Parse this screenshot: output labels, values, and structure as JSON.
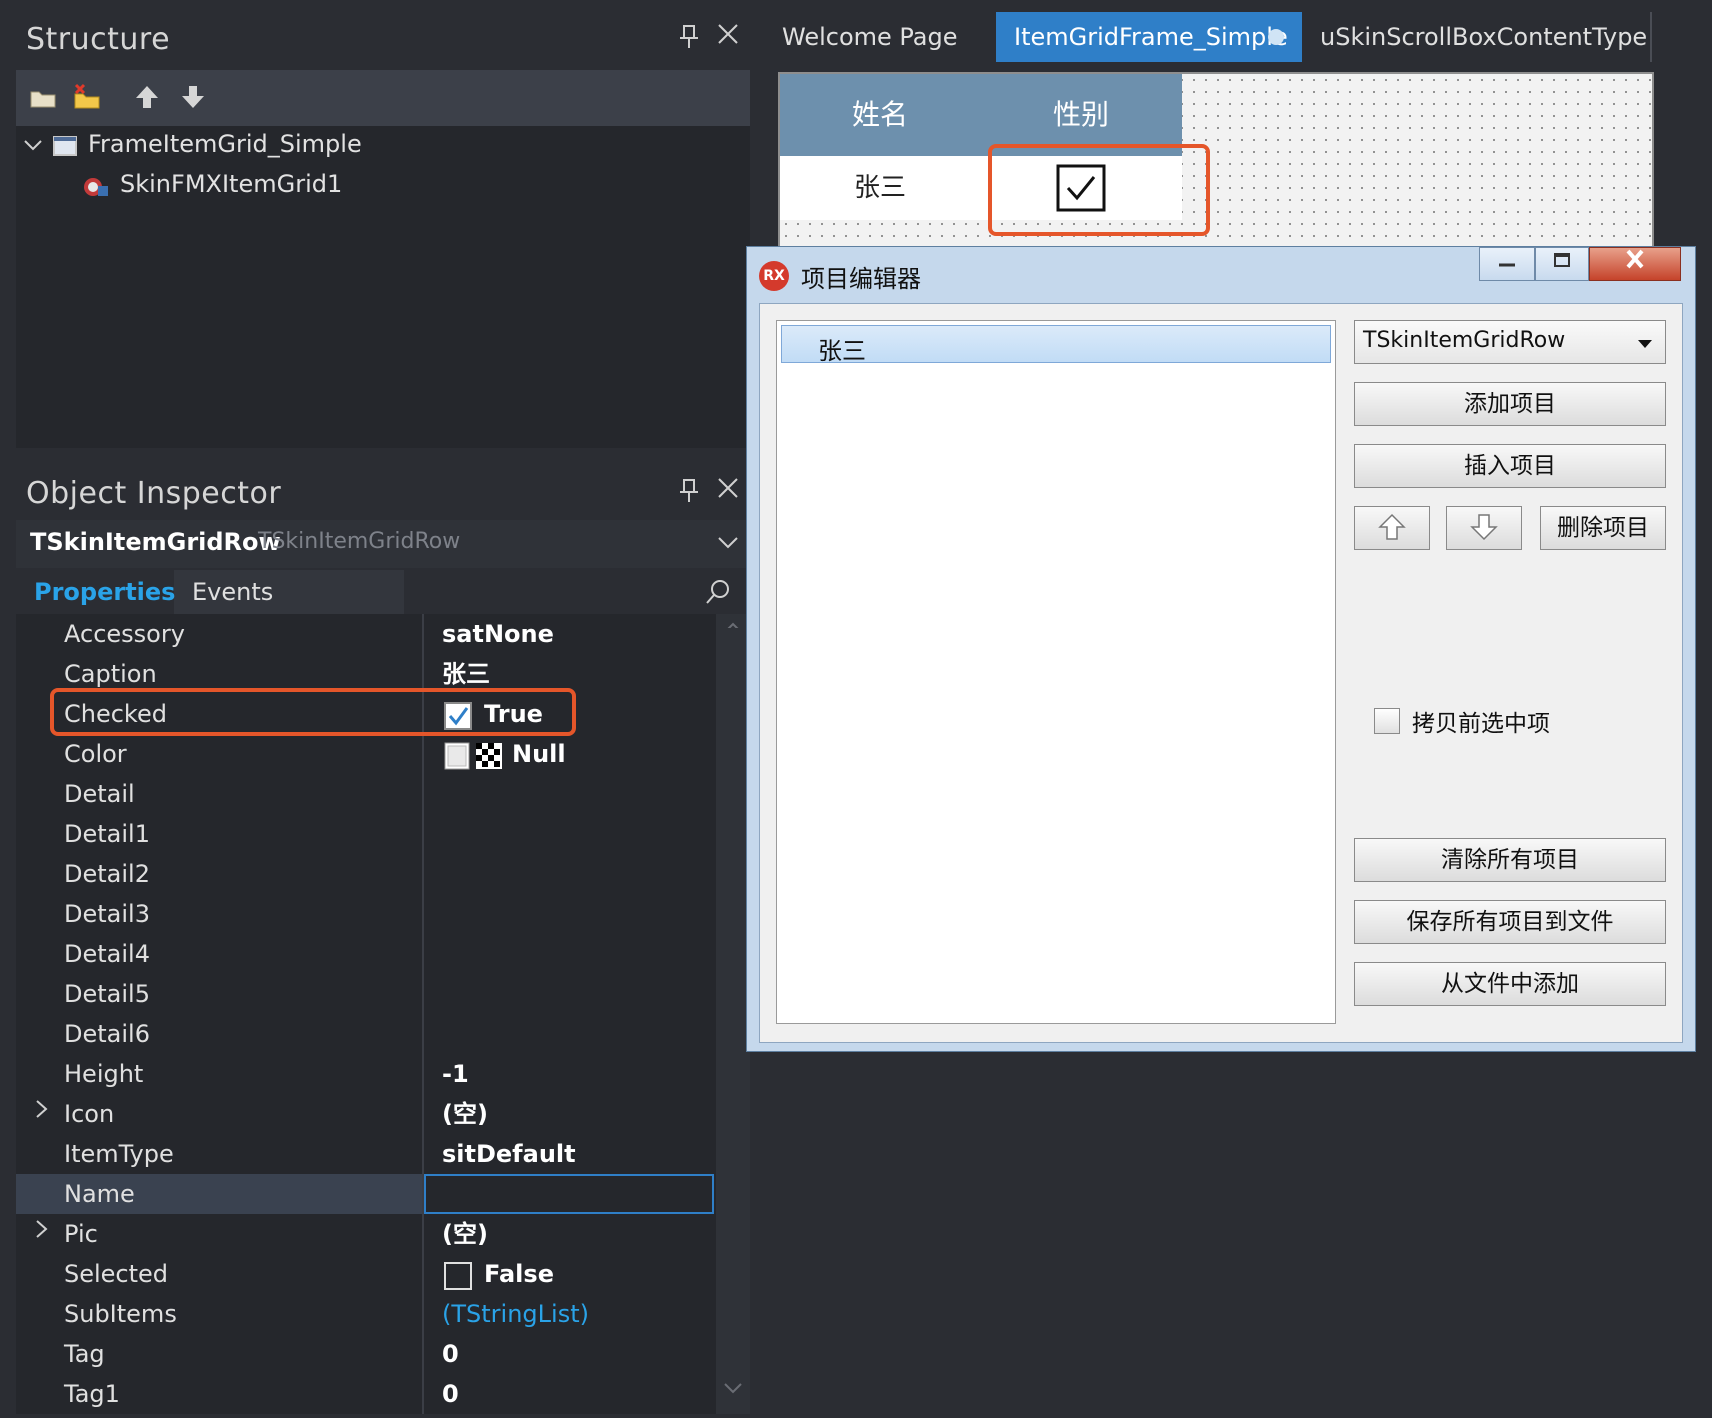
{
  "structure": {
    "title": "Structure",
    "pin_glyph": "⊥",
    "close_glyph": "✕",
    "tree": {
      "root_label": "FrameItemGrid_Simple",
      "child_label": "SkinFMXItemGrid1"
    }
  },
  "inspector": {
    "title": "Object Inspector",
    "selected_name": "TSkinItemGridRow",
    "selected_type": "TSkinItemGridRow",
    "tabs": [
      "Properties",
      "Events"
    ],
    "properties": [
      {
        "name": "Accessory",
        "value": "satNone"
      },
      {
        "name": "Caption",
        "value": "张三"
      },
      {
        "name": "Checked",
        "value": "True"
      },
      {
        "name": "Color",
        "value": "Null"
      },
      {
        "name": "Detail",
        "value": ""
      },
      {
        "name": "Detail1",
        "value": ""
      },
      {
        "name": "Detail2",
        "value": ""
      },
      {
        "name": "Detail3",
        "value": ""
      },
      {
        "name": "Detail4",
        "value": ""
      },
      {
        "name": "Detail5",
        "value": ""
      },
      {
        "name": "Detail6",
        "value": ""
      },
      {
        "name": "Height",
        "value": "-1"
      },
      {
        "name": "Icon",
        "value": "(空)"
      },
      {
        "name": "ItemType",
        "value": "sitDefault"
      },
      {
        "name": "Name",
        "value": ""
      },
      {
        "name": "Pic",
        "value": "(空)"
      },
      {
        "name": "Selected",
        "value": "False"
      },
      {
        "name": "SubItems",
        "value": "(TStringList)"
      },
      {
        "name": "Tag",
        "value": "0"
      },
      {
        "name": "Tag1",
        "value": "0"
      }
    ]
  },
  "editor": {
    "tabs": [
      "Welcome Page",
      "ItemGridFrame_Simple",
      "uSkinScrollBoxContentType"
    ],
    "grid": {
      "col_name": "姓名",
      "col_gender": "性别",
      "row_name": "张三"
    }
  },
  "dialog": {
    "title": "项目编辑器",
    "logo_text": "RX",
    "list_items": [
      "张三"
    ],
    "type_select": "TSkinItemGridRow",
    "add_button": "添加项目",
    "insert_button": "插入项目",
    "delete_button": "删除项目",
    "copy_checkbox": "拷贝前选中项",
    "clear_button": "清除所有项目",
    "save_button": "保存所有项目到文件",
    "load_button": "从文件中添加"
  },
  "colors": {
    "highlight": "#e5562a",
    "accent_blue": "#2f7fc8",
    "link_blue": "#2aa3e8",
    "grid_header": "#6d90ad"
  }
}
